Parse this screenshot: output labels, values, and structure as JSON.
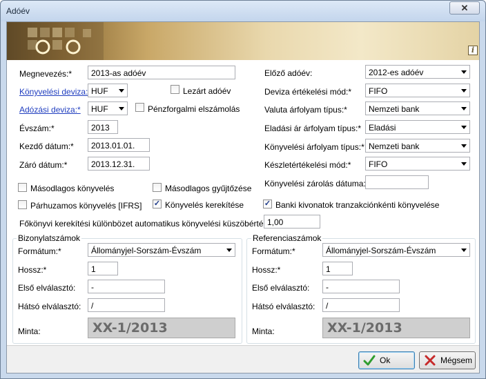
{
  "window": {
    "title": "Adóév",
    "close_label": "✕"
  },
  "left": {
    "megnevezes_label": "Megnevezés:*",
    "megnevezes_value": "2013-as adóév",
    "konyvelesi_deviza_label": "Könyvelési deviza:*",
    "konyvelesi_deviza_value": "HUF",
    "lezart_label": "Lezárt adóév",
    "adozasi_deviza_label": "Adózási deviza:*",
    "adozasi_deviza_value": "HUF",
    "penzforgalmi_label": "Pénzforgalmi elszámolás",
    "evszam_label": "Évszám:*",
    "evszam_value": "2013",
    "kezdo_label": "Kezdő dátum:*",
    "kezdo_value": "2013.01.01.",
    "zaro_label": "Záró dátum:*",
    "zaro_value": "2013.12.31."
  },
  "right": {
    "elozo_label": "Előző adóév:",
    "elozo_value": "2012-es adóév",
    "deviza_ert_label": "Deviza értékelési mód:*",
    "deviza_ert_value": "FIFO",
    "valuta_label": "Valuta árfolyam típus:*",
    "valuta_value": "Nemzeti bank",
    "eladasi_label": "Eladási ár árfolyam típus:*",
    "eladasi_value": "Eladási",
    "konyv_arf_label": "Könyvelési árfolyam típus:*",
    "konyv_arf_value": "Nemzeti bank",
    "keszlet_label": "Készletértékelési mód:*",
    "keszlet_value": "FIFO",
    "zarolas_label": "Könyvelési zárolás dátuma:",
    "zarolas_value": ""
  },
  "checks": {
    "masodlagos_konyveles": {
      "label": "Másodlagos könyvelés",
      "checked": false
    },
    "masodlagos_gyujto": {
      "label": "Másodlagos gyűjtőzése",
      "checked": false
    },
    "parhuzamos": {
      "label": "Párhuzamos könyvelés [IFRS]",
      "checked": false
    },
    "kerekites": {
      "label": "Könyvelés kerekítése",
      "checked": true
    },
    "banki": {
      "label": "Banki kivonatok tranzakciónkénti könyvelése",
      "checked": true
    }
  },
  "threshold": {
    "label": "Főkönyvi kerekítési különbözet automatikus könyvelési küszöbérték:*",
    "value": "1,00"
  },
  "bizonylat": {
    "title": "Bizonylatszámok",
    "format_label": "Formátum:*",
    "format_value": "Állományjel-Sorszám-Évszám",
    "hossz_label": "Hossz:*",
    "hossz_value": "1",
    "elso_label": "Első elválasztó:",
    "elso_value": "-",
    "hatso_label": "Hátsó elválasztó:",
    "hatso_value": "/",
    "minta_label": "Minta:",
    "minta_value": "XX-1/2013"
  },
  "referencia": {
    "title": "Referenciaszámok",
    "format_label": "Formátum:*",
    "format_value": "Állományjel-Sorszám-Évszám",
    "hossz_label": "Hossz:*",
    "hossz_value": "1",
    "elso_label": "Első elválasztó:",
    "elso_value": "-",
    "hatso_label": "Hátsó elválasztó:",
    "hatso_value": "/",
    "minta_label": "Minta:",
    "minta_value": "XX-1/2013"
  },
  "buttons": {
    "ok": "Ok",
    "cancel": "Mégsem"
  },
  "colors": {
    "link": "#1f3dbf",
    "accent": "#3c7fb1",
    "banner": "#c9a868"
  },
  "icons": {
    "ok": "checkmark-icon",
    "cancel": "x-icon",
    "info": "info-icon",
    "close": "close-icon"
  }
}
